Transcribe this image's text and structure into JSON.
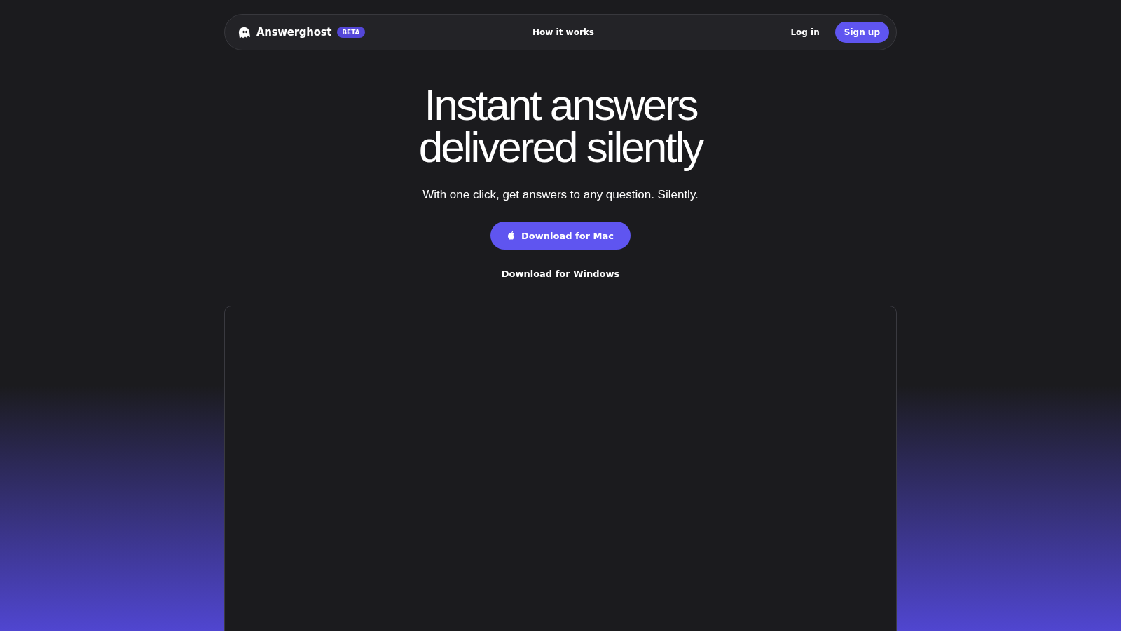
{
  "nav": {
    "brand": "Answerghost",
    "badge": "BETA",
    "links": [
      "How it works"
    ],
    "login": "Log in",
    "signup": "Sign up"
  },
  "hero": {
    "title_lines": [
      "Instant answers",
      "delivered silently"
    ],
    "subtitle": "With one click, get answers to any question. Silently.",
    "primary_button": "Download for Mac",
    "secondary_link": "Download for Windows"
  }
}
